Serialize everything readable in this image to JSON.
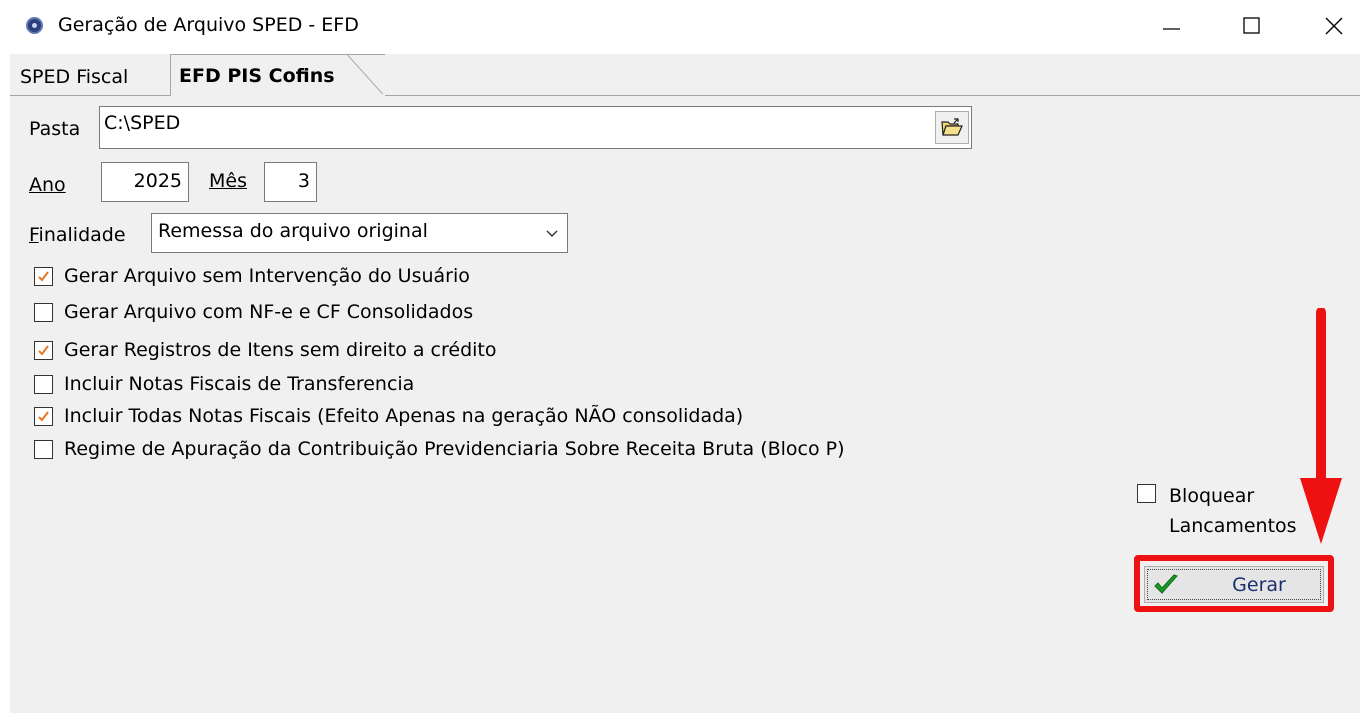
{
  "window": {
    "title": "Geração de Arquivo SPED - EFD",
    "icon": "app-icon",
    "controls": [
      "minimize-icon",
      "maximize-icon",
      "close-icon"
    ]
  },
  "tabs": [
    {
      "label": "SPED Fiscal",
      "active": false
    },
    {
      "label": "EFD PIS Cofins",
      "active": true
    }
  ],
  "form": {
    "pasta_label": "Pasta",
    "pasta_value": "C:\\SPED",
    "ano_label": "Ano",
    "ano_value": "2025",
    "mes_label": "Mês",
    "mes_value": "3",
    "finalidade_label": "Finalidade",
    "finalidade_value": "Remessa do arquivo original"
  },
  "options": [
    {
      "label": "Gerar Arquivo sem Intervenção do Usuário",
      "checked": true
    },
    {
      "label": "Gerar Arquivo com NF-e e CF Consolidados",
      "checked": false
    },
    {
      "label": "Gerar Registros de Itens sem direito a crédito",
      "checked": true
    },
    {
      "label": "Incluir Notas Fiscais de Transferencia",
      "checked": false
    },
    {
      "label": "Incluir Todas Notas Fiscais (Efeito Apenas na geração NÃO consolidada)",
      "checked": true
    },
    {
      "label": "Regime de Apuração da Contribuição Previdenciaria Sobre Receita Bruta (Bloco P)",
      "checked": false
    }
  ],
  "bloquear": {
    "line1": "Bloquear",
    "line2": "Lancamentos",
    "checked": false
  },
  "gerar_button": {
    "label": "Gerar",
    "icon": "check-icon"
  },
  "colors": {
    "highlight": "#ee1111",
    "check_orange": "#e87722",
    "gerar_check": "#1a9b2a"
  }
}
